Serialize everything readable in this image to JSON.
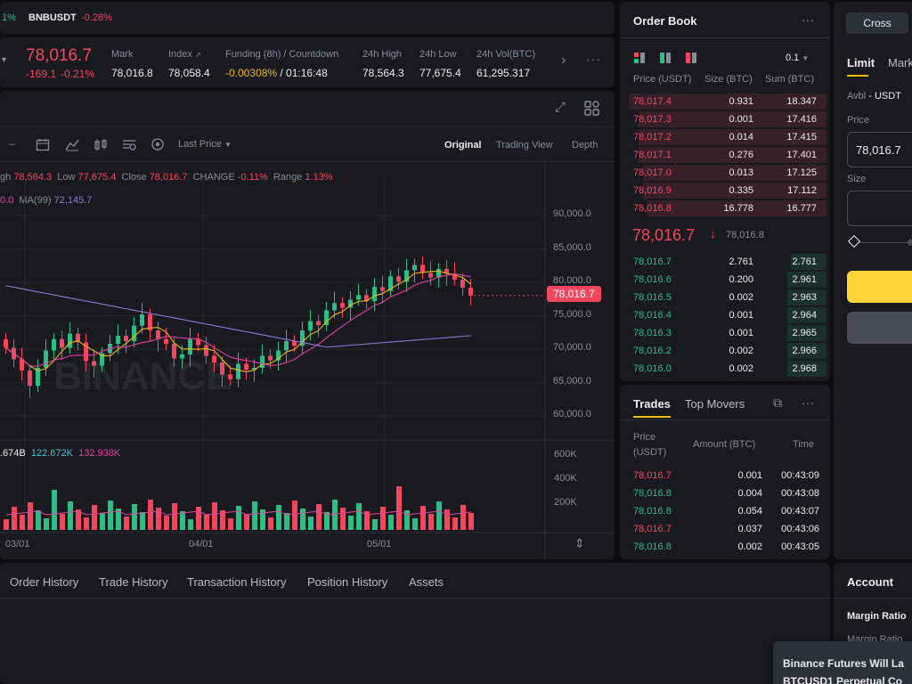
{
  "ticker_strip": {
    "prev_change": "1%",
    "symbol": "BNBUSDT",
    "change": "-0.28%"
  },
  "ticker": {
    "last_price": "78,016.7",
    "change_abs": "-169.1",
    "change_pct": "-0.21%",
    "stats": [
      {
        "label": "Mark",
        "value": "78,016.8"
      },
      {
        "label": "Index",
        "value": "78,058.4"
      },
      {
        "label": "Funding (8h) / Countdown",
        "value_neg": "-0.00308%",
        "value_rest": " / 01:16:48"
      },
      {
        "label": "24h High",
        "value": "78,564.3"
      },
      {
        "label": "24h Low",
        "value": "77,675.4"
      },
      {
        "label": "24h Vol(BTC)",
        "value": "61,295.317"
      }
    ]
  },
  "chart": {
    "price_type": "Last Price",
    "views": [
      "Original",
      "Trading View",
      "Depth"
    ],
    "ohlc": {
      "high_label": "gh",
      "high": "78,564.3",
      "low_label": "Low",
      "low": "77,675.4",
      "close_label": "Close",
      "close": "78,016.7",
      "change_label": "CHANGE",
      "change": "-0.11%",
      "range_label": "Range",
      "range": "1.13%"
    },
    "ma_line": {
      "first": "0.0",
      "ma99_label": "MA(99)",
      "ma99": "72,145.7"
    },
    "vol_line": {
      "v1": ".674B",
      "v2": "122.672K",
      "v3": "132.938K"
    },
    "price_ticks": [
      "90,000.0",
      "85,000.0",
      "80,000.0",
      "75,000.0",
      "70,000.0",
      "65,000.0",
      "60,000.0"
    ],
    "vol_ticks": [
      "600K",
      "400K",
      "200K"
    ],
    "date_ticks": [
      "03/01",
      "04/01",
      "05/01"
    ],
    "current_price_tag": "78,016.7",
    "watermark": "BINANCE",
    "colors": {
      "up": "#2ebd85",
      "down": "#f6465d",
      "ma7": "#f0b90b",
      "ma25": "#e040a0",
      "ma99": "#8a7ad8"
    }
  },
  "chart_data": {
    "type": "candlestick",
    "ylim": [
      58000,
      92000
    ],
    "price_ticks": [
      90000,
      85000,
      80000,
      75000,
      70000,
      65000,
      60000
    ],
    "closes": [
      70200,
      68500,
      66800,
      64500,
      67200,
      69800,
      71500,
      70200,
      72300,
      71000,
      68200,
      67500,
      69400,
      70800,
      72000,
      71200,
      73500,
      75200,
      72800,
      71500,
      70800,
      68600,
      69200,
      71500,
      70600,
      69000,
      68000,
      66200,
      65500,
      67800,
      66900,
      67200,
      69000,
      68300,
      69800,
      71200,
      70500,
      72800,
      74200,
      73600,
      75800,
      76900,
      76200,
      77400,
      78100,
      77200,
      79300,
      78700,
      80900,
      80100,
      81800,
      82600,
      81400,
      80700,
      82000,
      81300,
      80400,
      79200,
      78016.7
    ]
  },
  "orderbook": {
    "title": "Order Book",
    "precision": "0.1",
    "headers": [
      "Price (USDT)",
      "Size (BTC)",
      "Sum (BTC)"
    ],
    "asks": [
      {
        "price": "78,017.4",
        "size": "0.931",
        "sum": "18.347",
        "depth": 1.0
      },
      {
        "price": "78,017.3",
        "size": "0.001",
        "sum": "17.416",
        "depth": 0.95
      },
      {
        "price": "78,017.2",
        "size": "0.014",
        "sum": "17.415",
        "depth": 0.95
      },
      {
        "price": "78,017.1",
        "size": "0.276",
        "sum": "17.401",
        "depth": 0.95
      },
      {
        "price": "78,017.0",
        "size": "0.013",
        "sum": "17.125",
        "depth": 0.93
      },
      {
        "price": "78,016.9",
        "size": "0.335",
        "sum": "17.112",
        "depth": 0.93
      },
      {
        "price": "78,016.8",
        "size": "16.778",
        "sum": "16.777",
        "depth": 0.91
      }
    ],
    "mid_price": "78,016.7",
    "mid_mark": "78,016.8",
    "bids": [
      {
        "price": "78,016.7",
        "size": "2.761",
        "sum": "2.761",
        "depth": 0.18
      },
      {
        "price": "78,016.6",
        "size": "0.200",
        "sum": "2.961",
        "depth": 0.2
      },
      {
        "price": "78,016.5",
        "size": "0.002",
        "sum": "2.963",
        "depth": 0.2
      },
      {
        "price": "78,016.4",
        "size": "0.001",
        "sum": "2.964",
        "depth": 0.2
      },
      {
        "price": "78,016.3",
        "size": "0.001",
        "sum": "2.965",
        "depth": 0.2
      },
      {
        "price": "78,016.2",
        "size": "0.002",
        "sum": "2.966",
        "depth": 0.2
      },
      {
        "price": "78,016.0",
        "size": "0.002",
        "sum": "2.968",
        "depth": 0.2
      }
    ]
  },
  "trades": {
    "tab_trades": "Trades",
    "tab_movers": "Top Movers",
    "headers": {
      "price1": "Price",
      "price2": "(USDT)",
      "amount": "Amount (BTC)",
      "time": "Time"
    },
    "rows": [
      {
        "price": "78,016.7",
        "side": "sell",
        "amount": "0.001",
        "time": "00:43:09"
      },
      {
        "price": "78,016.8",
        "side": "buy",
        "amount": "0.004",
        "time": "00:43:08"
      },
      {
        "price": "78,016.8",
        "side": "buy",
        "amount": "0.054",
        "time": "00:43:07"
      },
      {
        "price": "78,016.7",
        "side": "sell",
        "amount": "0.037",
        "time": "00:43:06"
      },
      {
        "price": "78,016.8",
        "side": "buy",
        "amount": "0.002",
        "time": "00:43:05"
      }
    ]
  },
  "order_form": {
    "margin_mode": "Cross",
    "tab_limit": "Limit",
    "tab_market": "Mark",
    "avbl_label": "Avbl",
    "avbl_value": "- USDT",
    "price_label": "Price",
    "price_value": "78,016.7",
    "size_label": "Size"
  },
  "bottom": {
    "tabs": [
      "Order History",
      "Trade History",
      "Transaction History",
      "Position History",
      "Assets"
    ]
  },
  "account": {
    "title": "Account",
    "margin_ratio": "Margin Ratio",
    "margin_ratio_sub": "Margin Ratio"
  },
  "toast": {
    "line1": "Binance Futures Will La",
    "line2": "BTCUSD1 Perpetual Co"
  }
}
